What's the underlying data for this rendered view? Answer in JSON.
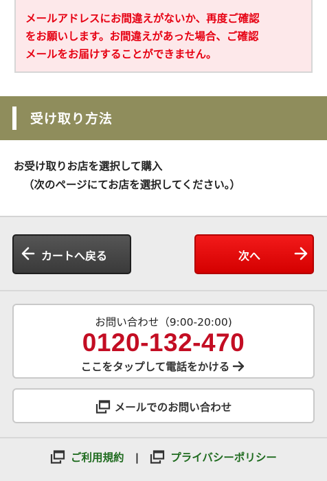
{
  "warning": {
    "text": "メールアドレスにお間違えがないか、再度ご確認\nをお願いします。お間違えがあった場合、ご確認\nメールをお届けすることができません。"
  },
  "section": {
    "title": "受け取り方法"
  },
  "method": {
    "line1": "お受け取りお店を選択して購入",
    "line2": "（次のページにてお店を選択してください。）"
  },
  "buttons": {
    "back_label": "カートへ戻る",
    "next_label": "次へ"
  },
  "contact": {
    "hours": "お問い合わせ（9:00-20:00)",
    "phone": "0120-132-470",
    "tap_label": "ここをタップして電話をかける",
    "mail_label": "メールでのお問い合わせ"
  },
  "footer": {
    "terms_label": "ご利用規約",
    "separator": "|",
    "privacy_label": "プライバシーポリシー"
  },
  "colors": {
    "warning_text": "#e60012",
    "section_header": "#8f8d5c",
    "next_button": "#e60012",
    "phone_number": "#c30d23",
    "footer_link": "#1f6b1f"
  },
  "icons": {
    "back": "arrow-left-icon",
    "next": "arrow-right-icon",
    "tap": "arrow-right-icon",
    "external": "external-window-icon"
  }
}
